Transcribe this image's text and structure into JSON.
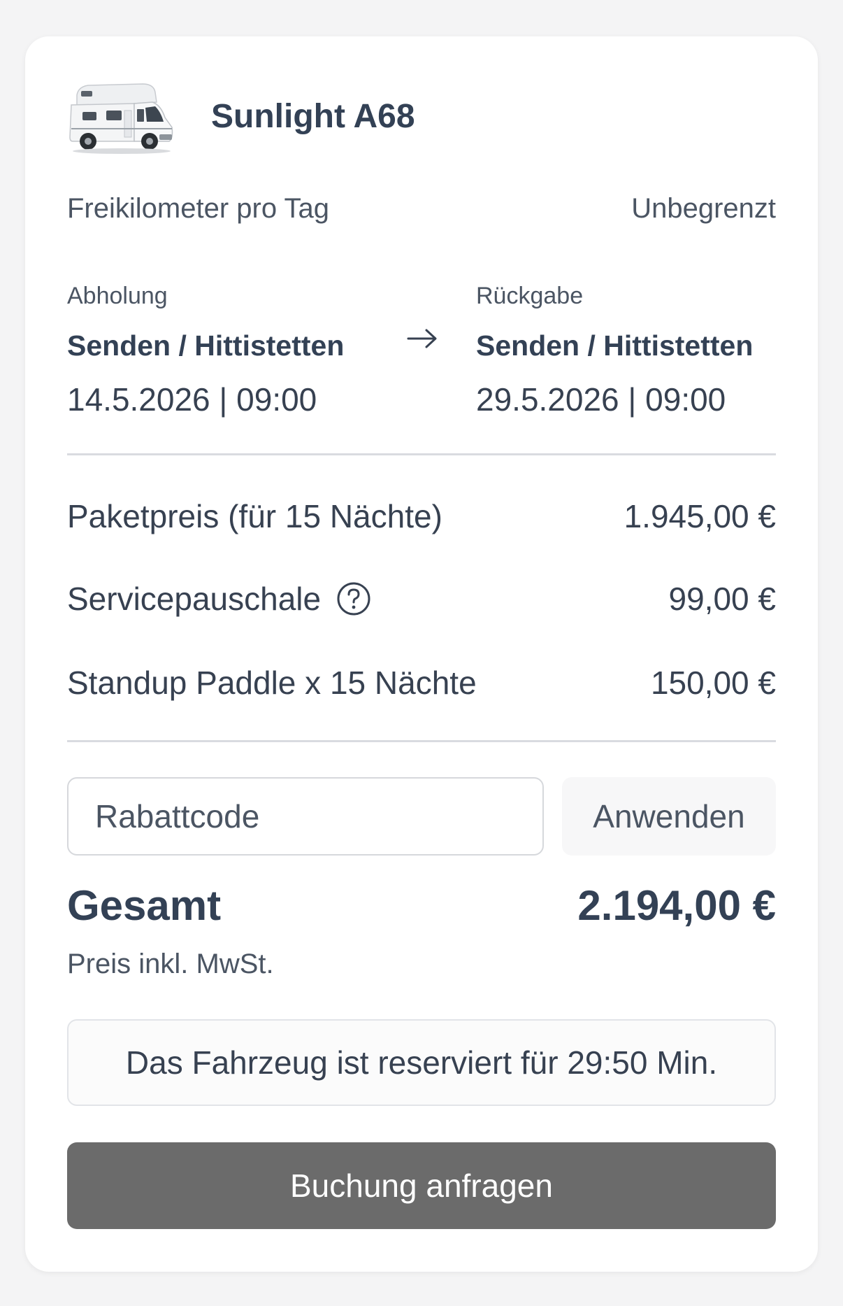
{
  "vehicle": {
    "name": "Sunlight A68"
  },
  "mileage": {
    "label": "Freikilometer pro Tag",
    "value": "Unbegrenzt"
  },
  "pickup": {
    "label": "Abholung",
    "place": "Senden / Hittistetten",
    "datetime": "14.5.2026 | 09:00"
  },
  "return": {
    "label": "Rückgabe",
    "place": "Senden / Hittistetten",
    "datetime": "29.5.2026 | 09:00"
  },
  "prices": [
    {
      "label": "Paketpreis (für 15 Nächte)",
      "amount": "1.945,00 €"
    },
    {
      "label": "Servicepauschale",
      "amount": "99,00 €"
    },
    {
      "label": "Standup Paddle x 15 Nächte",
      "amount": "150,00 €"
    }
  ],
  "coupon": {
    "placeholder": "Rabattcode",
    "value": "",
    "button_label": "Anwenden"
  },
  "total": {
    "label": "Gesamt",
    "amount": "2.194,00 €",
    "note": "Preis inkl. MwSt."
  },
  "reservation_notice": "Das Fahrzeug ist reserviert für 29:50 Min.",
  "cta": {
    "label": "Buchung anfragen"
  },
  "colors": {
    "background": "#f4f4f5",
    "card": "#ffffff",
    "text_dark": "#334155",
    "button": "#6b6b6b"
  },
  "icons": [
    "camper-van-image",
    "arrow-right-icon",
    "question-circle-icon"
  ]
}
